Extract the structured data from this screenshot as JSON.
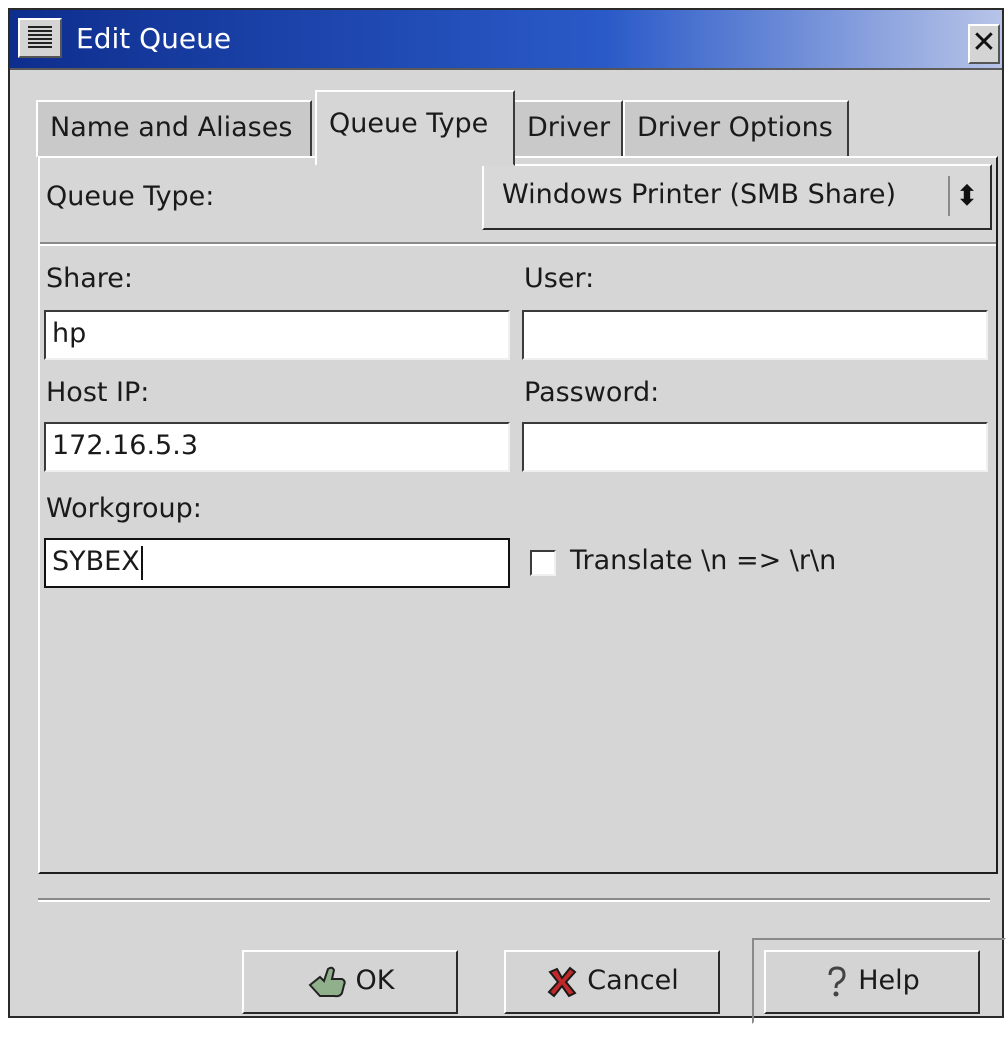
{
  "window": {
    "title": "Edit Queue",
    "icons": {
      "menu": "window-menu-icon",
      "close": "close-icon"
    },
    "colors": {
      "titlebar_start": "#0e2e8e",
      "titlebar_end": "#b8c4e8",
      "background": "#d6d6d6"
    }
  },
  "tabs": [
    {
      "label": "Name and Aliases",
      "active": false
    },
    {
      "label": "Queue Type",
      "active": true
    },
    {
      "label": "Driver",
      "active": false
    },
    {
      "label": "Driver Options",
      "active": false
    }
  ],
  "queue_type": {
    "label": "Queue Type:",
    "selected": "Windows Printer (SMB Share)",
    "arrow_icon": "updown-arrows-icon"
  },
  "fields": {
    "share": {
      "label": "Share:",
      "value": "hp"
    },
    "user": {
      "label": "User:",
      "value": ""
    },
    "host_ip": {
      "label": "Host IP:",
      "value": "172.16.5.3"
    },
    "password": {
      "label": "Password:",
      "value": ""
    },
    "workgroup": {
      "label": "Workgroup:",
      "value": "SYBEX"
    }
  },
  "translate": {
    "label": "Translate \\n => \\r\\n",
    "checked": false
  },
  "buttons": {
    "ok": {
      "label": "OK",
      "icon": "ok-hand-icon"
    },
    "cancel": {
      "label": "Cancel",
      "icon": "cancel-x-icon"
    },
    "help": {
      "label": "Help",
      "icon": "help-question-icon"
    }
  }
}
